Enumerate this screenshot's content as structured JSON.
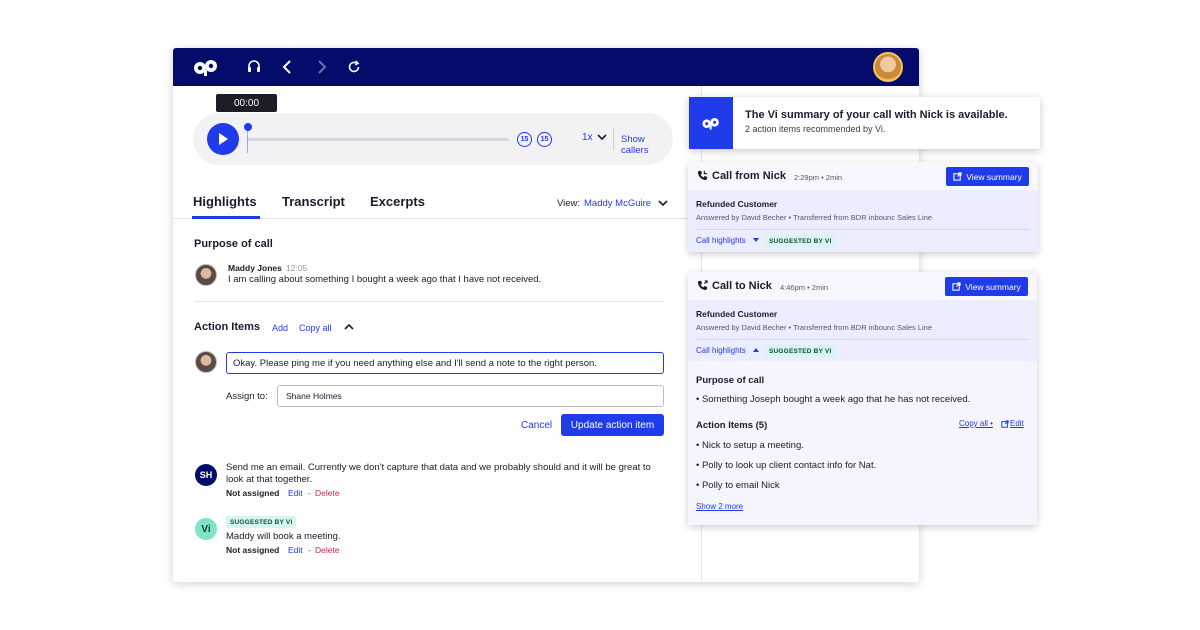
{
  "colors": {
    "navy": "#050b6b",
    "accent": "#1f3bea",
    "danger": "#d8234a",
    "suggested_bg": "#d6f5ee"
  },
  "player": {
    "time": "00:00",
    "skip_back": "15",
    "skip_fwd": "15",
    "speed": "1x",
    "show_callers": "Show callers"
  },
  "tabs": [
    {
      "label": "Highlights"
    },
    {
      "label": "Transcript"
    },
    {
      "label": "Excerpts"
    }
  ],
  "view": {
    "label": "View:",
    "value": "Maddy McGuire"
  },
  "purpose": {
    "heading": "Purpose of call",
    "name": "Maddy Jones",
    "time": "12:05",
    "text": "I am calling about something I bought a week ago that I have not received."
  },
  "actions": {
    "heading": "Action Items",
    "add": "Add",
    "copy_all": "Copy all",
    "edit_value": "Okay. Please ping me if you need anything else and I'll send a note to the right person.",
    "assign_label": "Assign to:",
    "assign_value": "Shane Holmes",
    "cancel": "Cancel",
    "update": "Update action item",
    "items": [
      {
        "initials": "SH",
        "text": "Send me an email. Currently we don't capture that data and we probably should and it will be great to look at that together.",
        "status": "Not assigned",
        "edit": "Edit",
        "sep": "-",
        "delete": "Delete"
      },
      {
        "initials": "Vi",
        "badge": "SUGGESTED BY VI",
        "text": "Maddy will book a meeting.",
        "status": "Not assigned",
        "edit": "Edit",
        "sep": "-",
        "delete": "Delete"
      }
    ]
  },
  "notification": {
    "title": "The Vi summary of your call with Nick is available.",
    "subtitle": "2 action items recommended by Vi."
  },
  "card1": {
    "title": "Call from Nick",
    "meta": "2:29pm • 2min",
    "view_summary": "View summary",
    "label": "Refunded Customer",
    "detail": "Answered by David Becher • Transferred from BDR inbounc Sales Line",
    "highlights": "Call highlights",
    "badge": "SUGGESTED BY VI"
  },
  "card2": {
    "title": "Call to Nick",
    "meta": "4:46pm • 2min",
    "view_summary": "View summary",
    "label": "Refunded Customer",
    "detail": "Answered by David Becher • Transferred from BDR inbounc Sales Line",
    "highlights": "Call highlights",
    "badge": "SUGGESTED BY VI",
    "purpose_heading": "Purpose of call",
    "purpose_text": "Something Joseph bought a week ago that he has not received.",
    "actions_heading": "Action Items (5)",
    "copy_all": "Copy all •",
    "edit": "Edit",
    "items": [
      "Nick to setup a meeting.",
      "Polly to look up client contact info for Nat.",
      "Polly to email Nick"
    ],
    "show_more": "Show 2 more"
  }
}
